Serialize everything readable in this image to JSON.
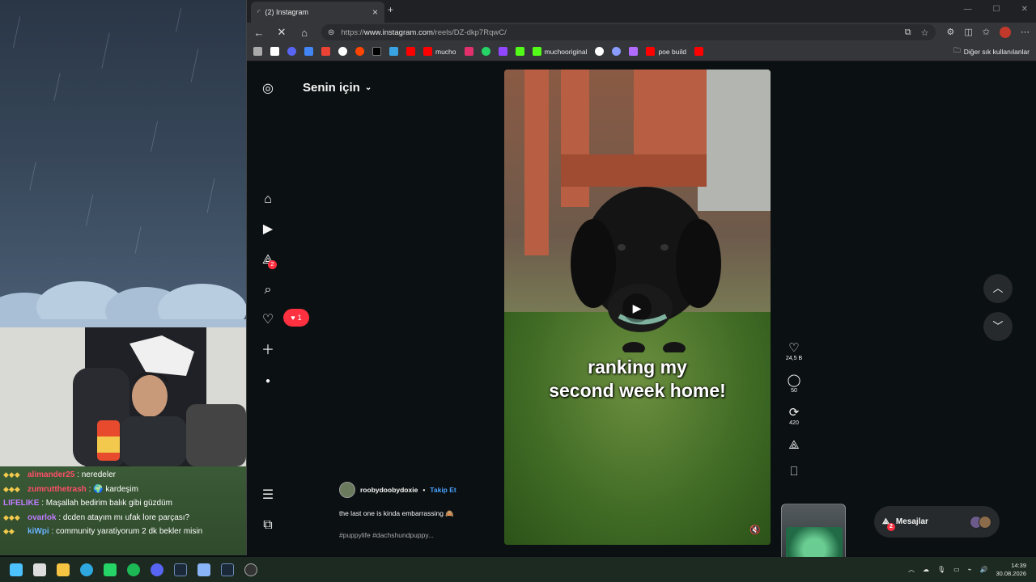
{
  "browser": {
    "tab_title": "(2) Instagram",
    "url_prefix": "https://",
    "url_domain": "www.instagram.com",
    "url_path": "/reels/DZ-dkp7RqwC/",
    "bookmarks": [
      {
        "label": "",
        "color": "#aaaaaa"
      },
      {
        "label": "",
        "color": "#ffffff"
      },
      {
        "label": "",
        "color": "#5865f2"
      },
      {
        "label": "",
        "color": "#4285f4"
      },
      {
        "label": "",
        "color": "#ea4335"
      },
      {
        "label": "",
        "color": "#ffffff"
      },
      {
        "label": "",
        "color": "#ff4500"
      },
      {
        "label": "",
        "color": "#000000"
      },
      {
        "label": "",
        "color": "#3aa3e3"
      },
      {
        "label": "",
        "color": "#ff0000"
      },
      {
        "label": "mucho",
        "color": "#ff0000"
      },
      {
        "label": "",
        "color": "#e1306c"
      },
      {
        "label": "",
        "color": "#25d366"
      },
      {
        "label": "",
        "color": "#9146ff"
      },
      {
        "label": "",
        "color": "#53fc18"
      },
      {
        "label": "muchooriginal",
        "color": "#53fc18"
      },
      {
        "label": "",
        "color": "#ffffff"
      },
      {
        "label": "",
        "color": "#8a9cff"
      },
      {
        "label": "",
        "color": "#b26bff"
      },
      {
        "label": "poe build",
        "color": "#ff0000"
      },
      {
        "label": "",
        "color": "#ff0000"
      }
    ],
    "other_bookmarks": "Diğer sık kullanılanlar"
  },
  "instagram": {
    "header": "Senin için",
    "nav_messages_badge": "2",
    "notification_count": "1",
    "video_caption_line1": "ranking my",
    "video_caption_line2": "second week home!",
    "username": "roobydoobydoxie",
    "follow_label": "Takip Et",
    "description": "the last one is kinda embarrassing 🙈",
    "hashtags": "#puppylife #dachshundpuppy...",
    "likes": "24,5 B",
    "comments": "50",
    "reposts": "420",
    "messages_label": "Mesajlar",
    "messages_badge": "2"
  },
  "chat": [
    {
      "user": "alimander25",
      "color": "#ff4f6a",
      "text": "neredeler"
    },
    {
      "user": "zumrutthetrash",
      "color": "#ff4f6a",
      "text": "kardeşim"
    },
    {
      "user": "LIFELIKE",
      "color": "#c07cff",
      "text": "Maşallah bedirim balık gibi güzdüm"
    },
    {
      "user": "ovarlok",
      "color": "#c07cff",
      "text": "dcden atayım mı ufak lore parçası?"
    },
    {
      "user": "kiWpi",
      "color": "#6ab4ff",
      "text": "community yaratiyorum 2 dk bekler misin"
    }
  ],
  "taskbar": {
    "time": "14:39",
    "date": "30.08.2026"
  }
}
